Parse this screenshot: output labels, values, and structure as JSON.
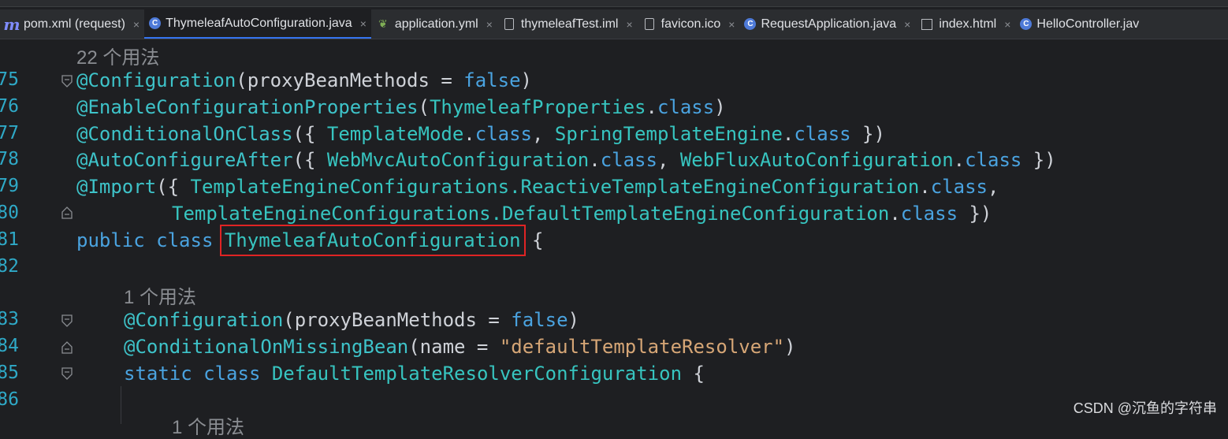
{
  "tabs": [
    {
      "label": "pom.xml (request)",
      "icon": "maven-m-icon",
      "close": "×",
      "active": false
    },
    {
      "label": "ThymeleafAutoConfiguration.java",
      "icon": "java-class-icon",
      "close": "×",
      "active": true
    },
    {
      "label": "application.yml",
      "icon": "spring-config-icon",
      "close": "×",
      "active": false
    },
    {
      "label": "thymeleafTest.iml",
      "icon": "file-icon",
      "close": "×",
      "active": false
    },
    {
      "label": "favicon.ico",
      "icon": "file-icon",
      "close": "×",
      "active": false
    },
    {
      "label": "RequestApplication.java",
      "icon": "java-class-icon",
      "close": "×",
      "active": false
    },
    {
      "label": "index.html",
      "icon": "html-icon",
      "close": "×",
      "active": false
    },
    {
      "label": "HelloController.jav",
      "icon": "java-class-icon",
      "close": "",
      "active": false
    }
  ],
  "usage_hints": {
    "h1": "22 个用法",
    "h2": "1 个用法",
    "h3": "1 个用法"
  },
  "line_numbers": [
    "75",
    "76",
    "77",
    "78",
    "79",
    "80",
    "81",
    "82",
    "83",
    "84",
    "85",
    "86"
  ],
  "code": {
    "l75": {
      "a": "@Configuration",
      "b": "(proxyBeanMethods = ",
      "c": "false",
      "d": ")"
    },
    "l76": {
      "a": "@EnableConfigurationProperties",
      "b": "(",
      "c": "ThymeleafProperties",
      "d": ".",
      "e": "class",
      "f": ")"
    },
    "l77": {
      "a": "@ConditionalOnClass",
      "b": "({ ",
      "c": "TemplateMode",
      "d": ".",
      "e": "class",
      "f": ", ",
      "g": "SpringTemplateEngine",
      "h": ".",
      "i": "class",
      "j": " })"
    },
    "l78": {
      "a": "@AutoConfigureAfter",
      "b": "({ ",
      "c": "WebMvcAutoConfiguration",
      "d": ".",
      "e": "class",
      "f": ", ",
      "g": "WebFluxAutoConfiguration",
      "h": ".",
      "i": "class",
      "j": " })"
    },
    "l79": {
      "a": "@Import",
      "b": "({ ",
      "c": "TemplateEngineConfigurations.ReactiveTemplateEngineConfiguration",
      "d": ".",
      "e": "class",
      "f": ","
    },
    "l80": {
      "c": "TemplateEngineConfigurations.DefaultTemplateEngineConfiguration",
      "d": ".",
      "e": "class",
      "f": " })"
    },
    "l81": {
      "a": "public",
      "b": " ",
      "c": "class",
      "d": " ",
      "e": "ThymeleafAutoConfiguration",
      "f": " {"
    },
    "l83": {
      "a": "@Configuration",
      "b": "(proxyBeanMethods = ",
      "c": "false",
      "d": ")"
    },
    "l84": {
      "a": "@ConditionalOnMissingBean",
      "b": "(name = ",
      "c": "\"defaultTemplateResolver\"",
      "d": ")"
    },
    "l85": {
      "a": "static",
      "b": " ",
      "c": "class",
      "d": " ",
      "e": "DefaultTemplateResolverConfiguration",
      "f": " {"
    }
  },
  "watermark": "CSDN @沉鱼的字符串"
}
